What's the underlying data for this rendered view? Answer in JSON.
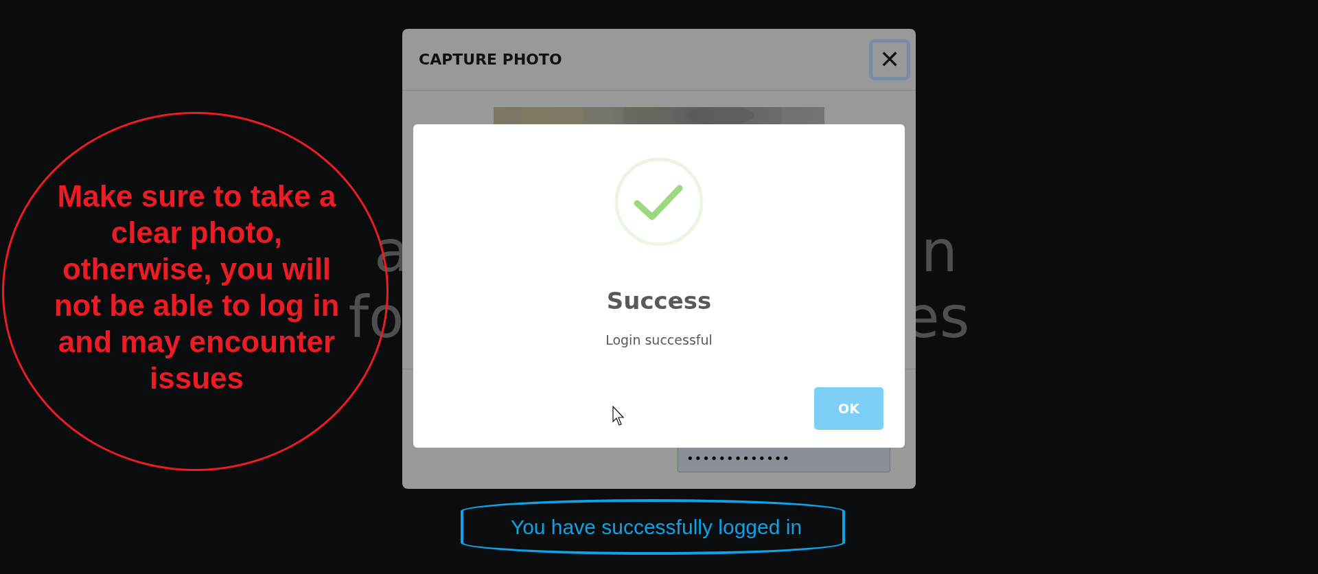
{
  "background_lines": [
    {
      "left": "a",
      "right": "n"
    },
    {
      "left": "fo",
      "right": "es"
    }
  ],
  "capture_modal": {
    "title": "CAPTURE PHOTO",
    "close_label": "✕",
    "password_value": "•••••••••••••"
  },
  "success_dialog": {
    "title": "Success",
    "message": "Login successful",
    "button": "OK"
  },
  "annotations": [
    {
      "kind": "red-circle",
      "text": "Make sure to take a clear photo, otherwise, you will not be able to log in and may encounter issues"
    },
    {
      "kind": "blue-oval",
      "text": "You have successfully logged in"
    }
  ]
}
